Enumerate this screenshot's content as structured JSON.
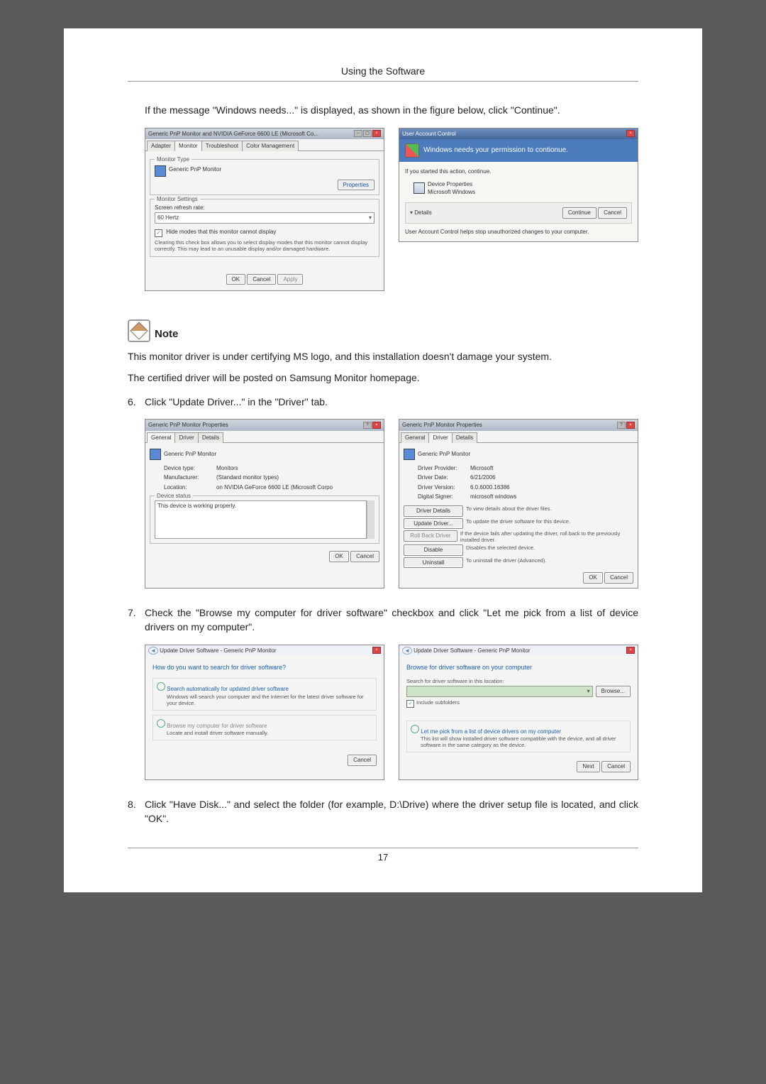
{
  "header": {
    "title": "Using the Software"
  },
  "intro": "If the message \"Windows needs...\" is displayed, as shown in the figure below, click \"Continue\".",
  "fig1_left": {
    "title": "Generic PnP Monitor and NVIDIA GeForce 6600 LE (Microsoft Co...",
    "tabs": [
      "Adapter",
      "Monitor",
      "Troubleshoot",
      "Color Management"
    ],
    "active_tab": 1,
    "group_type": "Monitor Type",
    "device": "Generic PnP Monitor",
    "btn_properties": "Properties",
    "group_settings": "Monitor Settings",
    "refresh_label": "Screen refresh rate:",
    "refresh_value": "60 Hertz",
    "hide_modes": "Hide modes that this monitor cannot display",
    "hide_note": "Clearing this check box allows you to select display modes that this monitor cannot display correctly. This may lead to an unusable display and/or damaged hardware.",
    "btn_ok": "OK",
    "btn_cancel": "Cancel",
    "btn_apply": "Apply"
  },
  "fig1_right": {
    "title": "User Account Control",
    "headline": "Windows needs your permission to contionue.",
    "started": "If you started this action, continue.",
    "program": "Device Properties",
    "publisher": "Microsoft Windows",
    "details": "Details",
    "btn_continue": "Continue",
    "btn_cancel": "Cancel",
    "footer": "User Account Control helps stop unauthorized changes to your computer."
  },
  "note": {
    "label": "Note",
    "line1": "This monitor driver is under certifying MS logo, and this installation doesn't damage your system.",
    "line2": "The certified driver will be posted on Samsung Monitor homepage."
  },
  "step6": {
    "num": "6.",
    "text": "Click \"Update Driver...\" in the \"Driver\" tab."
  },
  "fig2_left": {
    "title": "Generic PnP Monitor Properties",
    "tabs": [
      "General",
      "Driver",
      "Details"
    ],
    "active_tab": 0,
    "device": "Generic PnP Monitor",
    "rows": [
      [
        "Device type:",
        "Monitors"
      ],
      [
        "Manufacturer:",
        "(Standard monitor types)"
      ],
      [
        "Location:",
        "on NVIDIA GeForce 6600 LE (Microsoft Corpo"
      ]
    ],
    "status_label": "Device status",
    "status_text": "This device is working properly.",
    "btn_ok": "OK",
    "btn_cancel": "Cancel"
  },
  "fig2_right": {
    "title": "Generic PnP Monitor Properties",
    "tabs": [
      "General",
      "Driver",
      "Details"
    ],
    "active_tab": 1,
    "device": "Generic PnP Monitor",
    "rows": [
      [
        "Driver Provider:",
        "Microsoft"
      ],
      [
        "Driver Date:",
        "6/21/2006"
      ],
      [
        "Driver Version:",
        "6.0.6000.16386"
      ],
      [
        "Digital Signer:",
        "microsoft windows"
      ]
    ],
    "buttons": [
      {
        "label": "Driver Details",
        "desc": "To view details about the driver files."
      },
      {
        "label": "Update Driver...",
        "desc": "To update the driver software for this device."
      },
      {
        "label": "Roll Back Driver",
        "desc": "If the device fails after updating the driver, roll back to the previously installed driver."
      },
      {
        "label": "Disable",
        "desc": "Disables the selected device."
      },
      {
        "label": "Uninstall",
        "desc": "To uninstall the driver (Advanced)."
      }
    ],
    "btn_ok": "OK",
    "btn_cancel": "Cancel"
  },
  "step7": {
    "num": "7.",
    "text": "Check the \"Browse my computer for driver software\" checkbox and click \"Let me pick from a list of device drivers on my computer\"."
  },
  "fig3_left": {
    "breadcrumb": "Update Driver Software - Generic PnP Monitor",
    "heading": "How do you want to search for driver software?",
    "opt1_title": "Search automatically for updated driver software",
    "opt1_desc": "Windows will search your computer and the Internet for the latest driver software for your device.",
    "opt2_title": "Browse my computer for driver software",
    "opt2_desc": "Locate and install driver software manually.",
    "btn_cancel": "Cancel"
  },
  "fig3_right": {
    "breadcrumb": "Update Driver Software - Generic PnP Monitor",
    "heading": "Browse for driver software on your computer",
    "search_label": "Search for driver software in this location:",
    "path": "",
    "btn_browse": "Browse...",
    "include_sub": "Include subfolders",
    "opt_title": "Let me pick from a list of device drivers on my computer",
    "opt_desc": "This list will show installed driver software compatible with the device, and all driver software in the same category as the device.",
    "btn_next": "Next",
    "btn_cancel": "Cancel"
  },
  "step8": {
    "num": "8.",
    "text": "Click \"Have Disk...\" and select the folder (for example, D:\\Drive) where the driver setup file is located, and click \"OK\"."
  },
  "page_number": "17"
}
